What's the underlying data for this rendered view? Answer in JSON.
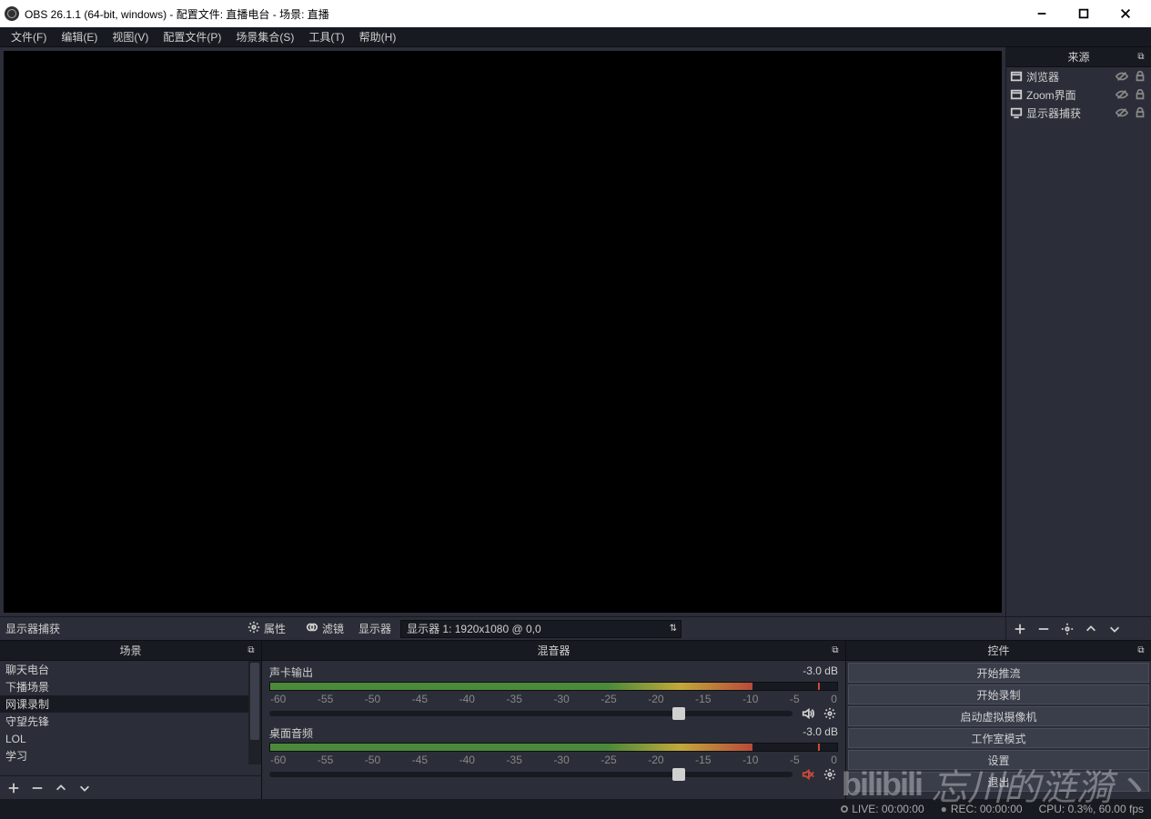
{
  "title": "OBS 26.1.1 (64-bit, windows) - 配置文件: 直播电台 - 场景: 直播",
  "menu": [
    "文件(F)",
    "编辑(E)",
    "视图(V)",
    "配置文件(P)",
    "场景集合(S)",
    "工具(T)",
    "帮助(H)"
  ],
  "sources_header": "来源",
  "sources": [
    {
      "icon": "window",
      "label": "浏览器"
    },
    {
      "icon": "window",
      "label": "Zoom界面"
    },
    {
      "icon": "monitor",
      "label": "显示器捕获"
    }
  ],
  "propbar": {
    "selected_source": "显示器捕获",
    "properties": "属性",
    "filters": "滤镜",
    "display_label": "显示器",
    "display_value": "显示器 1: 1920x1080 @ 0,0"
  },
  "scenes_header": "场景",
  "scenes": [
    "聊天电台",
    "下播场景",
    "网课录制",
    "守望先锋",
    "LOL",
    "学习"
  ],
  "scene_selected": 2,
  "mixer_header": "混音器",
  "mixer": [
    {
      "name": "声卡输出",
      "db": "-3.0 dB",
      "muted": false,
      "thumb": 77
    },
    {
      "name": "桌面音频",
      "db": "-3.0 dB",
      "muted": true,
      "thumb": 77
    }
  ],
  "ticks": [
    "-60",
    "-55",
    "-50",
    "-45",
    "-40",
    "-35",
    "-30",
    "-25",
    "-20",
    "-15",
    "-10",
    "-5",
    "0"
  ],
  "controls_header": "控件",
  "controls": [
    "开始推流",
    "开始录制",
    "启动虚拟摄像机",
    "工作室模式",
    "设置",
    "退出"
  ],
  "status": {
    "live": "LIVE: 00:00:00",
    "rec": "REC: 00:00:00",
    "cpu": "CPU: 0.3%, 60.00 fps"
  },
  "watermark": {
    "bili": "bilibili",
    "text": "忘川的涟漪丶"
  }
}
